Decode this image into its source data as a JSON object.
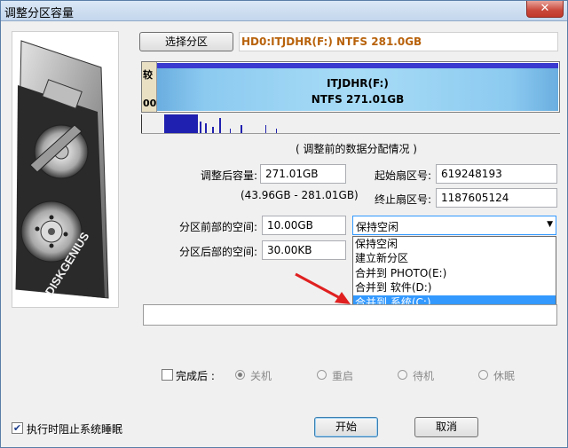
{
  "window": {
    "title": "调整分区容量",
    "close_glyph": "✕"
  },
  "logo": {
    "brand": "DISKGENIUS"
  },
  "select_partition_button": "选择分区",
  "partition_info": "HD0:ITJDHR(F:) NTFS 281.0GB",
  "partition_bar": {
    "left_segment_top": "较",
    "left_segment_bottom": "00",
    "label_line1": "ITJDHR(F:)",
    "label_line2": "NTFS 271.01GB"
  },
  "section_caption": "( 调整前的数据分配情况 )",
  "fields": {
    "size_after_label": "调整后容量:",
    "size_after_value": "271.01GB",
    "size_range": "(43.96GB - 281.01GB)",
    "start_sector_label": "起始扇区号:",
    "start_sector_value": "619248193",
    "end_sector_label": "终止扇区号:",
    "end_sector_value": "1187605124",
    "space_before_label": "分区前部的空间:",
    "space_before_value": "10.00GB",
    "space_after_label": "分区后部的空间:",
    "space_after_value": "30.00KB"
  },
  "space_action": {
    "selected": "保持空闲",
    "options": [
      "保持空闲",
      "建立新分区",
      "合并到 PHOTO(E:)",
      "合并到 软件(D:)",
      "合并到 系统(C:)"
    ],
    "highlighted_index": 4
  },
  "after_completion": {
    "label": "完成后 :",
    "checked": false,
    "options": [
      "关机",
      "重启",
      "待机",
      "休眠"
    ]
  },
  "prevent_sleep": {
    "label": "执行时阻止系统睡眠",
    "checked": true
  },
  "buttons": {
    "start": "开始",
    "cancel": "取消"
  },
  "colors": {
    "partition_info_text": "#b8620b",
    "highlight": "#3399ff",
    "arrow": "#e02020",
    "bar_fill": "#8ccaf0"
  }
}
